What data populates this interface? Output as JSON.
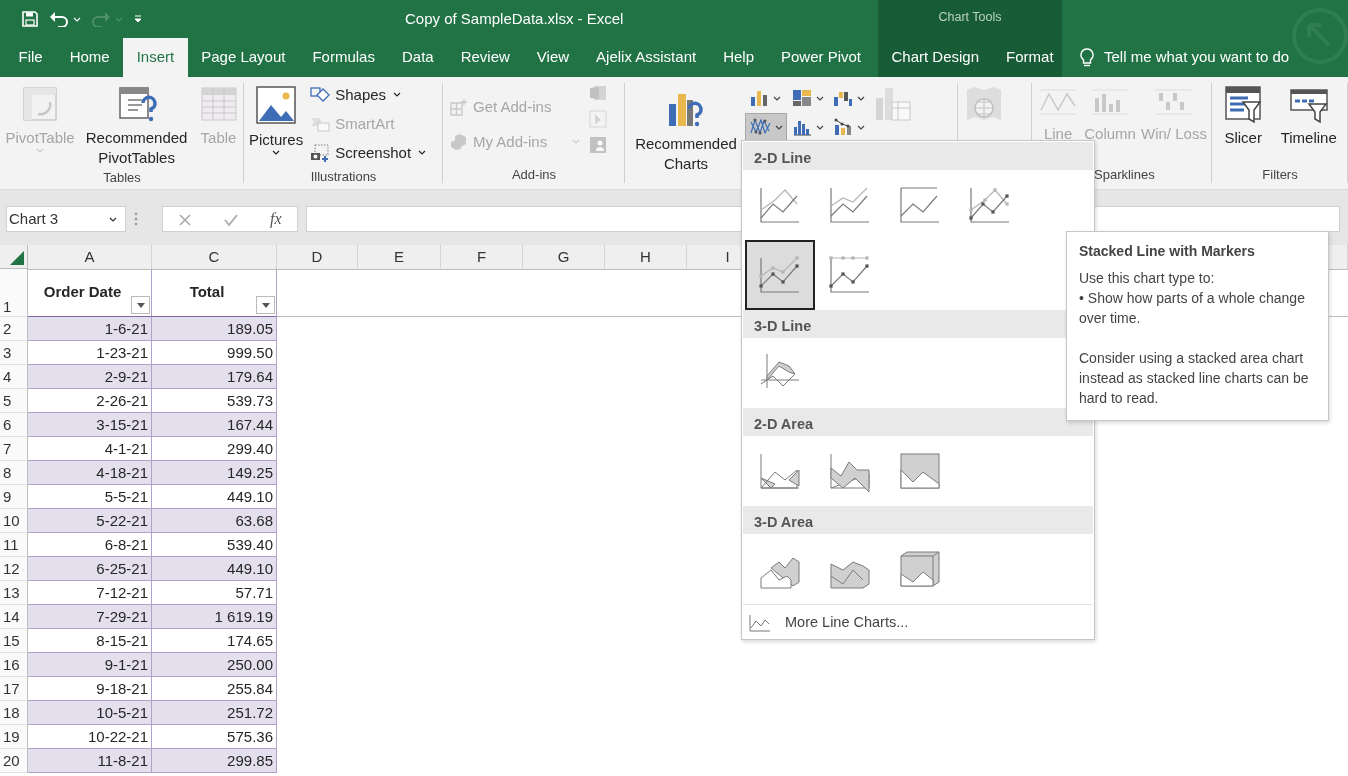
{
  "window": {
    "title": "Copy of SampleData.xlsx  -  Excel"
  },
  "quick_access": [
    {
      "kind": "save",
      "disabled": false
    },
    {
      "kind": "undo",
      "disabled": false
    },
    {
      "kind": "redo",
      "disabled": true
    },
    {
      "kind": "customize",
      "disabled": false
    }
  ],
  "contextual_group": {
    "label": "Chart Tools"
  },
  "tabs": [
    {
      "label": "File",
      "selected": false,
      "contextual": false
    },
    {
      "label": "Home",
      "selected": false,
      "contextual": false
    },
    {
      "label": "Insert",
      "selected": true,
      "contextual": false
    },
    {
      "label": "Page Layout",
      "selected": false,
      "contextual": false
    },
    {
      "label": "Formulas",
      "selected": false,
      "contextual": false
    },
    {
      "label": "Data",
      "selected": false,
      "contextual": false
    },
    {
      "label": "Review",
      "selected": false,
      "contextual": false
    },
    {
      "label": "View",
      "selected": false,
      "contextual": false
    },
    {
      "label": "Ajelix Assistant",
      "selected": false,
      "contextual": false
    },
    {
      "label": "Help",
      "selected": false,
      "contextual": false
    },
    {
      "label": "Power Pivot",
      "selected": false,
      "contextual": false
    },
    {
      "label": "Chart Design",
      "selected": false,
      "contextual": true
    },
    {
      "label": "Format",
      "selected": false,
      "contextual": true
    }
  ],
  "tell_me": {
    "text": "Tell me what you want to do"
  },
  "ribbon": [
    {
      "label": "Tables",
      "columns": [
        [
          {
            "kind": "large",
            "label": "PivotTable",
            "disabled": true,
            "dropdown": true
          }
        ],
        [
          {
            "kind": "large",
            "label": "Recommended PivotTables",
            "disabled": false,
            "dropdown": false
          }
        ],
        [
          {
            "kind": "large",
            "label": "Table",
            "disabled": true,
            "dropdown": false
          }
        ]
      ]
    },
    {
      "label": "Illustrations",
      "columns": [
        [
          {
            "kind": "large",
            "label": "Pictures",
            "disabled": false,
            "dropdown": true
          }
        ],
        [
          {
            "kind": "small",
            "label": "Shapes",
            "disabled": false,
            "dropdown": true
          },
          {
            "kind": "small",
            "label": "SmartArt",
            "disabled": true,
            "dropdown": false
          },
          {
            "kind": "small",
            "label": "Screenshot",
            "disabled": false,
            "dropdown": true
          }
        ]
      ]
    },
    {
      "label": "Add-ins",
      "columns": [
        [
          {
            "kind": "small",
            "label": "Get Add-ins",
            "disabled": true,
            "dropdown": false
          },
          {
            "kind": "small",
            "label": "My Add-ins",
            "disabled": true,
            "dropdown": true
          }
        ],
        [
          {
            "kind": "icon",
            "disabled": true
          },
          {
            "kind": "icon",
            "disabled": true
          },
          {
            "kind": "icon",
            "disabled": true
          }
        ]
      ]
    },
    {
      "columns": [
        [
          {
            "kind": "large",
            "label": "Recommended Charts",
            "disabled": false,
            "dropdown": false
          }
        ],
        [
          {
            "kind": "split",
            "disabled": false,
            "dropdown": true,
            "expanded": false
          },
          {
            "kind": "split",
            "disabled": false,
            "dropdown": true,
            "expanded": true
          }
        ],
        [
          {
            "kind": "split",
            "disabled": false,
            "dropdown": true,
            "expanded": false
          },
          {
            "kind": "split",
            "disabled": false,
            "dropdown": true,
            "expanded": false
          }
        ],
        [
          {
            "kind": "split",
            "disabled": false,
            "dropdown": true,
            "expanded": false
          },
          {
            "kind": "split",
            "disabled": false,
            "dropdown": true,
            "expanded": false
          }
        ],
        [
          {
            "kind": "large",
            "disabled": true,
            "dropdown": false
          }
        ]
      ]
    },
    {
      "columns": [
        [
          {
            "kind": "large",
            "disabled": true,
            "dropdown": false
          }
        ]
      ]
    },
    {
      "label": "Sparklines",
      "columns": [
        [
          {
            "kind": "large",
            "label": "Line",
            "disabled": true,
            "dropdown": false
          }
        ],
        [
          {
            "kind": "large",
            "label": "Column",
            "disabled": true,
            "dropdown": false
          }
        ],
        [
          {
            "kind": "large",
            "label": "Win/ Loss",
            "disabled": true,
            "dropdown": false
          }
        ]
      ]
    },
    {
      "label": "Filters",
      "columns": [
        [
          {
            "kind": "large",
            "label": "Slicer",
            "disabled": false,
            "dropdown": false
          }
        ],
        [
          {
            "kind": "large",
            "label": "Timeline",
            "disabled": false,
            "dropdown": false
          }
        ]
      ]
    }
  ],
  "formula_bar": {
    "name_box": "Chart 3",
    "function_label": "fx"
  },
  "sheet": {
    "columns": [
      "A",
      "C",
      "D",
      "E",
      "F",
      "G",
      "H",
      "I"
    ],
    "header_row": {
      "number": "1",
      "cells": [
        "Order Date",
        "Total"
      ]
    },
    "rows": [
      {
        "number": "2",
        "order_date": "1-6-21",
        "total": "189.05"
      },
      {
        "number": "3",
        "order_date": "1-23-21",
        "total": "999.50"
      },
      {
        "number": "4",
        "order_date": "2-9-21",
        "total": "179.64"
      },
      {
        "number": "5",
        "order_date": "2-26-21",
        "total": "539.73"
      },
      {
        "number": "6",
        "order_date": "3-15-21",
        "total": "167.44"
      },
      {
        "number": "7",
        "order_date": "4-1-21",
        "total": "299.40"
      },
      {
        "number": "8",
        "order_date": "4-18-21",
        "total": "149.25"
      },
      {
        "number": "9",
        "order_date": "5-5-21",
        "total": "449.10"
      },
      {
        "number": "10",
        "order_date": "5-22-21",
        "total": "63.68"
      },
      {
        "number": "11",
        "order_date": "6-8-21",
        "total": "539.40"
      },
      {
        "number": "12",
        "order_date": "6-25-21",
        "total": "449.10"
      },
      {
        "number": "13",
        "order_date": "7-12-21",
        "total": "57.71"
      },
      {
        "number": "14",
        "order_date": "7-29-21",
        "total": "1 619.19"
      },
      {
        "number": "15",
        "order_date": "8-15-21",
        "total": "174.65"
      },
      {
        "number": "16",
        "order_date": "9-1-21",
        "total": "250.00"
      },
      {
        "number": "17",
        "order_date": "9-18-21",
        "total": "255.84"
      },
      {
        "number": "18",
        "order_date": "10-5-21",
        "total": "251.72"
      },
      {
        "number": "19",
        "order_date": "10-22-21",
        "total": "575.36"
      },
      {
        "number": "20",
        "order_date": "11-8-21",
        "total": "299.85"
      }
    ]
  },
  "chart_menu": {
    "sections": [
      {
        "title": "2-D Line",
        "options": [
          {
            "kind": "line",
            "selected": false
          },
          {
            "kind": "stacked_line",
            "selected": false
          },
          {
            "kind": "stacked_line_100",
            "selected": false
          },
          {
            "kind": "line_markers",
            "selected": false
          },
          {
            "kind": "stacked_line_markers",
            "selected": true
          },
          {
            "kind": "stacked_line_100_markers",
            "selected": false
          }
        ]
      },
      {
        "title": "3-D Line",
        "options": [
          {
            "kind": "line_3d",
            "selected": false
          }
        ]
      },
      {
        "title": "2-D Area",
        "options": [
          {
            "kind": "area",
            "selected": false
          },
          {
            "kind": "stacked_area",
            "selected": false
          },
          {
            "kind": "stacked_area_100",
            "selected": false
          }
        ]
      },
      {
        "title": "3-D Area",
        "options": [
          {
            "kind": "area_3d",
            "selected": false
          },
          {
            "kind": "stacked_area_3d",
            "selected": false
          },
          {
            "kind": "stacked_area_100_3d",
            "selected": false
          }
        ]
      }
    ],
    "more": {
      "label": "More Line Charts..."
    }
  },
  "tooltip": {
    "title": "Stacked Line with Markers",
    "paragraphs": [
      [
        "Use this chart type to:",
        "• Show how parts of a whole change over time."
      ],
      [
        "Consider using a stacked area chart instead as stacked line charts can be hard to read."
      ]
    ]
  }
}
